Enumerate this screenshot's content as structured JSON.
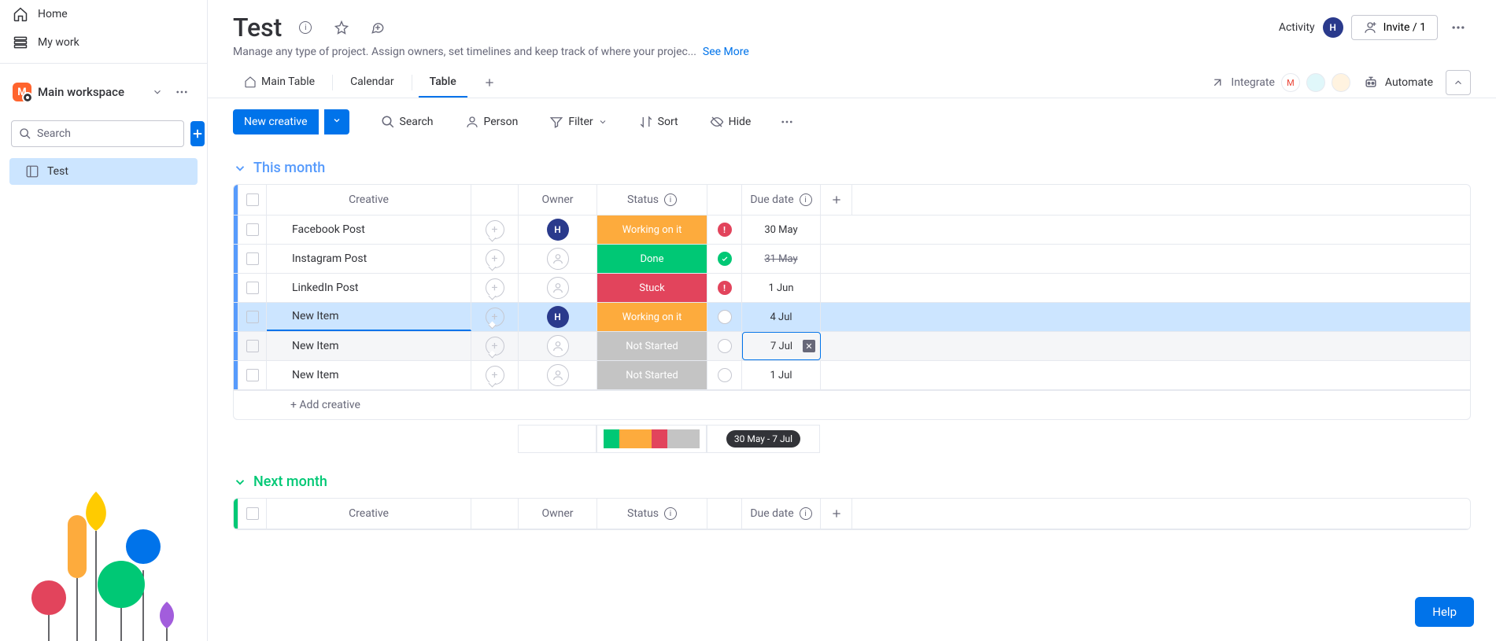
{
  "sidebar": {
    "home": "Home",
    "my_work": "My work",
    "workspace": {
      "badge": "M",
      "title": "Main workspace"
    },
    "search_placeholder": "Search",
    "board_item": "Test"
  },
  "header": {
    "title": "Test",
    "activity": "Activity",
    "avatar": "H",
    "invite": "Invite / 1",
    "description": "Manage any type of project. Assign owners, set timelines and keep track of where your projec...",
    "see_more": "See More"
  },
  "tabs": {
    "main_table": "Main Table",
    "calendar": "Calendar",
    "table": "Table",
    "integrate": "Integrate",
    "automate": "Automate"
  },
  "toolbar": {
    "new": "New creative",
    "search": "Search",
    "person": "Person",
    "filter": "Filter",
    "sort": "Sort",
    "hide": "Hide"
  },
  "groups": [
    {
      "title": "This month",
      "color": "#579bfc",
      "columns": {
        "creative": "Creative",
        "owner": "Owner",
        "status": "Status",
        "due": "Due date"
      },
      "rows": [
        {
          "name": "Facebook Post",
          "owner": "H",
          "status": "Working on it",
          "status_class": "working",
          "due": "30 May",
          "ind": "warn"
        },
        {
          "name": "Instagram Post",
          "owner": "",
          "status": "Done",
          "status_class": "done",
          "due": "31 May",
          "due_strike": true,
          "ind": "ok"
        },
        {
          "name": "LinkedIn Post",
          "owner": "",
          "status": "Stuck",
          "status_class": "stuck",
          "due": "1 Jun",
          "ind": "warn"
        },
        {
          "name": "New Item",
          "owner": "H",
          "status": "Working on it",
          "status_class": "working",
          "due": "4 Jul",
          "ind": "empty",
          "selected": true
        },
        {
          "name": "New Item",
          "owner": "",
          "status": "Not Started",
          "status_class": "notstarted",
          "due": "7 Jul",
          "ind": "empty",
          "hovered": true,
          "clearable": true
        },
        {
          "name": "New Item",
          "owner": "",
          "status": "Not Started",
          "status_class": "notstarted",
          "due": "1 Jul",
          "ind": "empty"
        }
      ],
      "add_placeholder": "+ Add creative",
      "summary": {
        "status_segments": [
          {
            "color": "#00c875",
            "pct": 16.7
          },
          {
            "color": "#fdab3d",
            "pct": 33.3
          },
          {
            "color": "#e2445c",
            "pct": 16.7
          },
          {
            "color": "#c4c4c4",
            "pct": 33.3
          }
        ],
        "date_range": "30 May - 7 Jul"
      }
    },
    {
      "title": "Next month",
      "color": "#00c875",
      "columns": {
        "creative": "Creative",
        "owner": "Owner",
        "status": "Status",
        "due": "Due date"
      },
      "rows": []
    }
  ],
  "help": "Help"
}
